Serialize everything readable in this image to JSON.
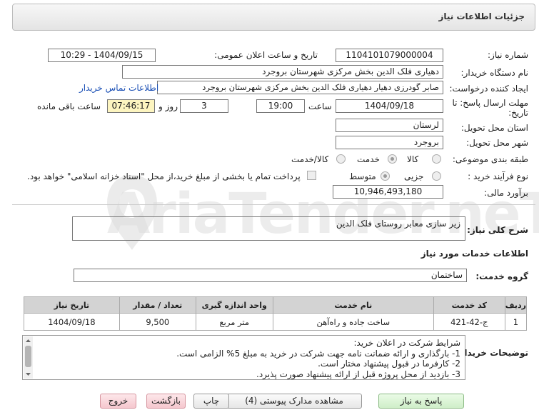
{
  "header": {
    "title": "جزئیات اطلاعات نیاز"
  },
  "need_number": {
    "label": "شماره نیاز:",
    "value": "1104101079000004"
  },
  "announce": {
    "label": "تاریخ و ساعت اعلان عمومی:",
    "value": "1404/09/15 - 10:29"
  },
  "buyer": {
    "label": "نام دستگاه خریدار:",
    "value": "دهیاری فلک الدین بخش مرکزی شهرستان بروجرد"
  },
  "creator": {
    "label": "ایجاد کننده درخواست:",
    "value": "صابر گودرزی دهیار دهیاری فلک الدین بخش مرکزی شهرستان بروجرد",
    "contact_link": "اطلاعات تماس خریدار"
  },
  "deadline": {
    "label1": "مهلت ارسال پاسخ: تا",
    "label2": "تاریخ:",
    "date": "1404/09/18",
    "time_label": "ساعت",
    "time": "19:00",
    "days": "3",
    "days_label": "روز و",
    "remaining": "07:46:17",
    "remaining_label": "ساعت باقی مانده"
  },
  "province": {
    "label": "استان محل تحویل:",
    "value": "لرستان"
  },
  "city": {
    "label": "شهر محل تحویل:",
    "value": "بروجرد"
  },
  "category": {
    "label": "طبقه بندی موضوعی:",
    "options": [
      "کالا",
      "خدمت",
      "کالا/خدمت"
    ],
    "selected": "خدمت"
  },
  "process": {
    "label": "نوع فرآیند خرید :",
    "options": [
      "جزیی",
      "متوسط"
    ],
    "selected": "متوسط",
    "payment_text": "پرداخت تمام یا بخشی از مبلغ خرید،از محل \"اسناد خزانه اسلامی\" خواهد بود."
  },
  "estimate": {
    "label": "برآورد مالی:",
    "value": "10,946,493,180"
  },
  "summary": {
    "label": "شرح کلی نیاز:",
    "value": "زیر سازی معابر روستای فلک الدین"
  },
  "services": {
    "title": "اطلاعات خدمات مورد نیاز",
    "group_label": "گروه خدمت:",
    "group_value": "ساختمان",
    "columns": [
      "ردیف",
      "کد خدمت",
      "نام خدمت",
      "واحد اندازه گیری",
      "تعداد / مقدار",
      "تاریخ نیاز"
    ],
    "rows": [
      [
        "1",
        "ج-42-421",
        "ساخت جاده و راه‌آهن",
        "متر مربع",
        "9,500",
        "1404/09/18"
      ]
    ]
  },
  "buyer_notes": {
    "label": "توضیحات خریدار:",
    "lines": [
      "شرایط شرکت در اعلان خرید:",
      "1-     بارگذاری و ارائه ضمانت نامه جهت شرکت در خرید به مبلغ 5% الزامی است.",
      "2-     کارفرما در قبول پیشنهاد مختار است.",
      "3-     بازدید از محل پروژه قبل از ارائه پیشنهاد صورت پذیرد."
    ]
  },
  "buttons": {
    "reply": "پاسخ به نیاز",
    "docs": "مشاهده مدارک پیوستی (4)",
    "print": "چاپ",
    "back": "بازگشت",
    "exit": "خروج"
  },
  "watermark": "AriaTender.neT",
  "colors": {
    "header_bg": "#e8e8e8",
    "highlight": "#fdf5c0",
    "link": "#1a4fb5",
    "green_btn": "#d6f2d0",
    "pink_btn": "#f8d2d8"
  }
}
